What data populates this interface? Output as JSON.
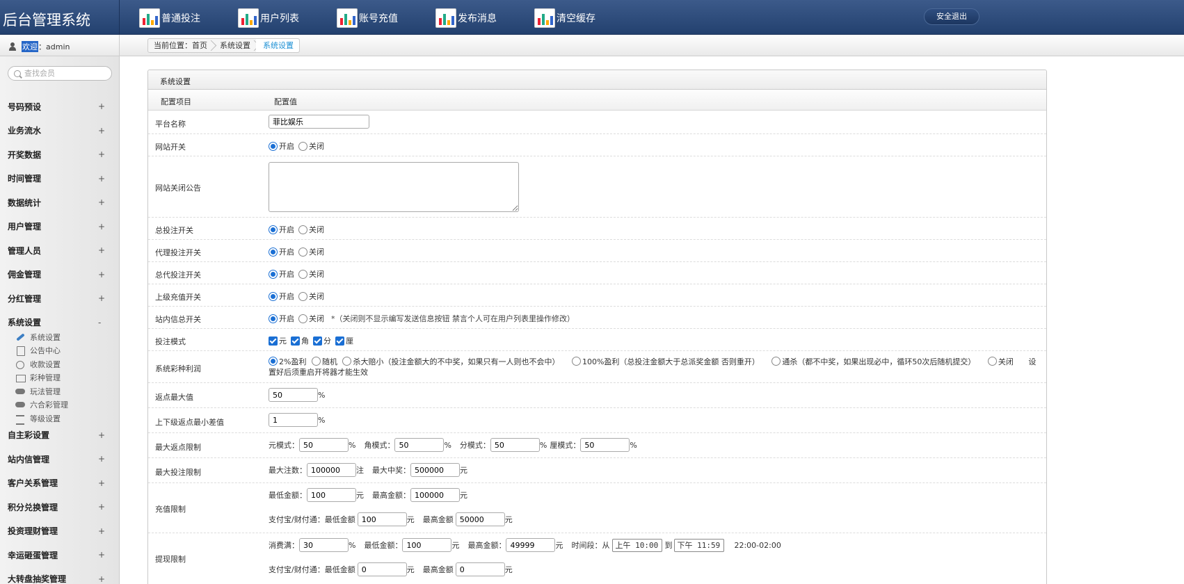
{
  "app": {
    "title": "后台管理系统"
  },
  "topnav": [
    {
      "label": "普通投注",
      "icon": "chart-icon"
    },
    {
      "label": "用户列表",
      "icon": "chart-icon"
    },
    {
      "label": "账号充值",
      "icon": "chart-icon"
    },
    {
      "label": "发布消息",
      "icon": "chart-icon"
    },
    {
      "label": "清空缓存",
      "icon": "chart-icon"
    }
  ],
  "logout_label": "安全退出",
  "welcome": {
    "label": "欢迎",
    "user": "：admin"
  },
  "breadcrumb": [
    "当前位置：首页",
    "系统设置",
    "系统设置"
  ],
  "search": {
    "placeholder": "查找会员"
  },
  "sidebar": {
    "groups_top": [
      {
        "label": "号码预设",
        "toggle": "+"
      },
      {
        "label": "业务流水",
        "toggle": "+"
      },
      {
        "label": "开奖数据",
        "toggle": "+"
      },
      {
        "label": "时间管理",
        "toggle": "+"
      },
      {
        "label": "数据统计",
        "toggle": "+"
      },
      {
        "label": "用户管理",
        "toggle": "+"
      },
      {
        "label": "管理人员",
        "toggle": "+"
      },
      {
        "label": "佣金管理",
        "toggle": "+"
      },
      {
        "label": "分红管理",
        "toggle": "+"
      },
      {
        "label": "系统设置",
        "toggle": "-"
      }
    ],
    "sub_items": [
      {
        "label": "系统设置",
        "icon": "wrench-icon"
      },
      {
        "label": "公告中心",
        "icon": "document-icon"
      },
      {
        "label": "收款设置",
        "icon": "coin-icon"
      },
      {
        "label": "彩种管理",
        "icon": "box-icon"
      },
      {
        "label": "玩法管理",
        "icon": "gamepad-icon"
      },
      {
        "label": "六合彩管理",
        "icon": "gamepad-icon"
      },
      {
        "label": "等级设置",
        "icon": "list-icon"
      }
    ],
    "groups_bottom": [
      {
        "label": "自主彩设置",
        "toggle": "+"
      },
      {
        "label": "站内信管理",
        "toggle": "+"
      },
      {
        "label": "客户关系管理",
        "toggle": "+"
      },
      {
        "label": "积分兑换管理",
        "toggle": "+"
      },
      {
        "label": "投资理财管理",
        "toggle": "+"
      },
      {
        "label": "幸运砸蛋管理",
        "toggle": "+"
      },
      {
        "label": "大转盘抽奖管理",
        "toggle": "+"
      }
    ]
  },
  "panel": {
    "title": "系统设置",
    "col_item": "配置项目",
    "col_value": "配置值"
  },
  "form": {
    "platform_name": {
      "label": "平台名称",
      "value": "菲比娱乐"
    },
    "site_switch": {
      "label": "网站开关",
      "on": "开启",
      "off": "关闭"
    },
    "close_notice": {
      "label": "网站关闭公告",
      "value": ""
    },
    "total_bet_switch": {
      "label": "总投注开关",
      "on": "开启",
      "off": "关闭"
    },
    "agent_bet_switch": {
      "label": "代理投注开关",
      "on": "开启",
      "off": "关闭"
    },
    "general_agent_bet_switch": {
      "label": "总代投注开关",
      "on": "开启",
      "off": "关闭"
    },
    "upper_recharge_switch": {
      "label": "上级充值开关",
      "on": "开启",
      "off": "关闭"
    },
    "internal_msg_switch": {
      "label": "站内信总开关",
      "on": "开启",
      "off": "关闭",
      "note": "*（关闭则不显示编写发送信息按钮 禁言个人可在用户列表里操作修改）"
    },
    "bet_mode": {
      "label": "投注模式",
      "options": [
        "元",
        "角",
        "分",
        "厘"
      ]
    },
    "lottery_profit": {
      "label": "系统彩种利润",
      "options": [
        "2%盈利",
        "随机",
        "杀大赔小（投注金额大的不中奖，如果只有一人则也不会中）",
        "100%盈利（总投注金额大于总派奖金额 否则重开）",
        "通杀（都不中奖，如果出现必中，循环50次后随机提交）",
        "关闭"
      ],
      "note": "设置好后须重启开将器才能生效"
    },
    "rebate_max": {
      "label": "返点最大值",
      "value": "50",
      "unit": "%"
    },
    "rebate_min_diff": {
      "label": "上下级返点最小差值",
      "value": "1",
      "unit": "%"
    },
    "max_rebate_limit": {
      "label": "最大返点限制",
      "yuan_label": "元模式：",
      "yuan": "50",
      "jiao_label": "角模式：",
      "jiao": "50",
      "fen_label": "分模式：",
      "fen": "50",
      "li_label": "厘模式：",
      "li": "50",
      "unit": "%"
    },
    "max_bet_limit": {
      "label": "最大投注限制",
      "count_label": "最大注数：",
      "count": "100000",
      "count_unit": "注",
      "prize_label": "最大中奖：",
      "prize": "500000",
      "prize_unit": "元"
    },
    "recharge_limit": {
      "label": "充值限制",
      "min_label": "最低金额：",
      "min": "100",
      "max_label": "最高金额：",
      "max": "100000",
      "alipay_label": "支付宝/财付通：",
      "alipay_min_label": "最低金额",
      "alipay_min": "100",
      "alipay_max_label": "最高金额",
      "alipay_max": "50000",
      "unit": "元"
    },
    "withdraw_limit": {
      "label": "提现限制",
      "consume_label": "消费满：",
      "consume": "30",
      "consume_unit": "%",
      "min_label": "最低金额：",
      "min": "100",
      "max_label": "最高金额：",
      "max": "49999",
      "unit": "元",
      "time_label": "时间段：",
      "from_label": "从",
      "from_time": "上午 10:00",
      "to_label": "到",
      "to_time": "下午 11:59",
      "range_text": "22:00-02:00",
      "alipay_label": "支付宝/财付通：",
      "alipay_min_label": "最低金额",
      "alipay_min": "0",
      "alipay_max_label": "最高金额",
      "alipay_max": "0"
    }
  },
  "colors": {
    "topbar": "#2d4b7b",
    "accent": "#1a6fd4",
    "breadcrumb_current": "#1a8fd4"
  }
}
